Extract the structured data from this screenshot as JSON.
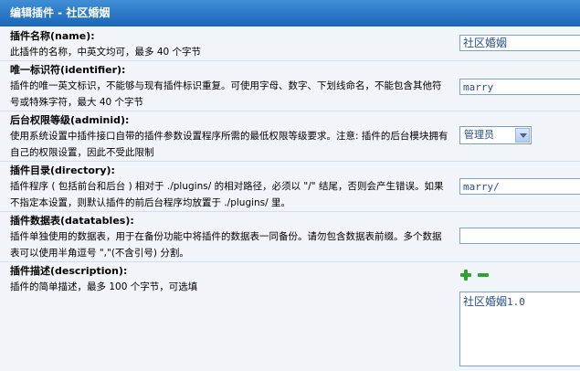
{
  "header": {
    "title": "编辑插件 - 社区婚姻"
  },
  "fields": {
    "name": {
      "title": "插件名称(name):",
      "desc": "此插件的名称，中英文均可，最多 40 个字节",
      "value": "社区婚姻"
    },
    "identifier": {
      "title": "唯一标识符(identifier):",
      "desc": "插件的唯一英文标识，不能够与现有插件标识重复。可使用字母、数字、下划线命名，不能包含其他符号或特殊字符，最大 40 个字节",
      "value": "marry"
    },
    "adminid": {
      "title": "后台权限等级(adminid):",
      "desc": "使用系统设置中插件接口自带的插件参数设置程序所需的最低权限等级要求。注意: 插件的后台模块拥有自己的权限设置，因此不受此限制",
      "selected": "管理员"
    },
    "directory": {
      "title": "插件目录(directory):",
      "desc": "插件程序 ( 包括前台和后台 ) 相对于 ./plugins/ 的相对路径，必须以 \"/\" 结尾，否则会产生错误。如果不指定本设置，则默认插件的前后台程序均放置于 ./plugins/ 里。",
      "value": "marry/"
    },
    "datatables": {
      "title": "插件数据表(datatables):",
      "desc": "插件单独使用的数据表，用于在备份功能中将插件的数据表一同备份。请勿包含数据表前缀。多个数据表可以使用半角逗号 \",\"(不含引号) 分割。",
      "value": ""
    },
    "description": {
      "title": "插件描述(description):",
      "desc": "插件的简单描述，最多 100 个字节，可选填",
      "value_cn": "社区婚姻",
      "value_version": "1.0"
    }
  }
}
